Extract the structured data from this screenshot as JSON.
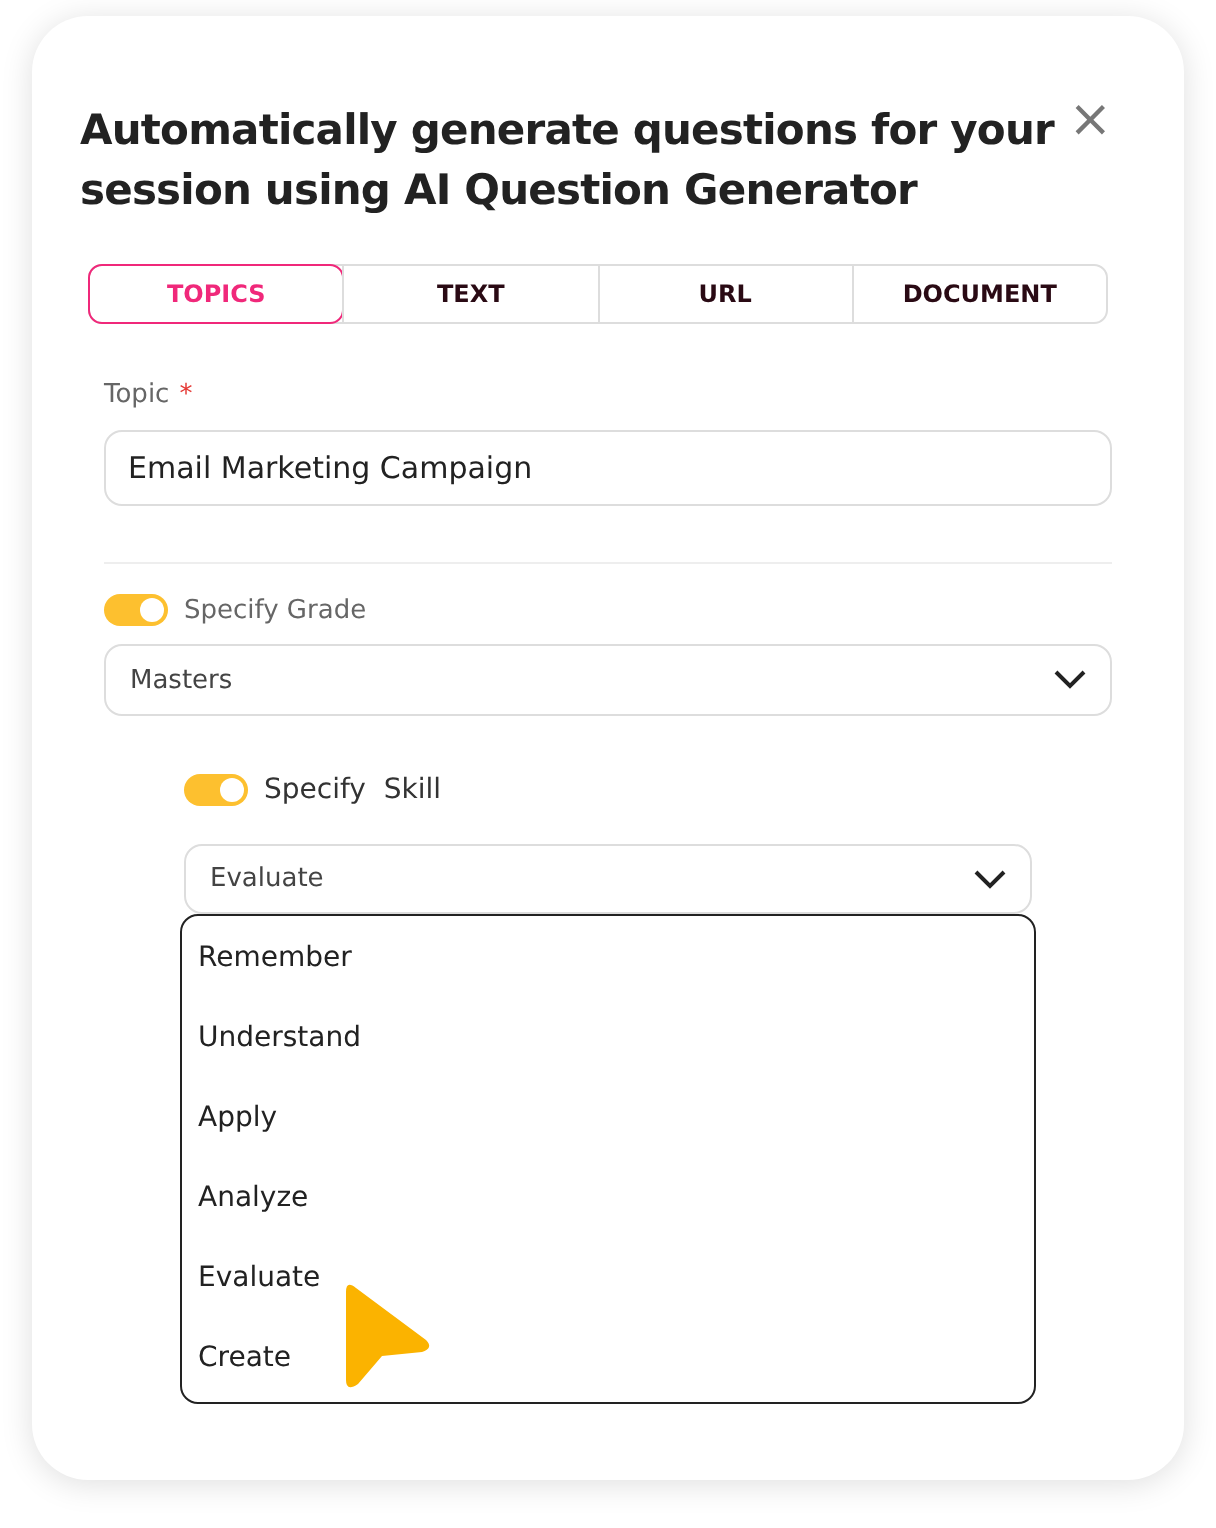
{
  "dialog": {
    "title": "Automatically generate questions for your session using AI Question Generator",
    "close": "×"
  },
  "tabs": [
    {
      "label": "TOPICS",
      "selected": true
    },
    {
      "label": "TEXT",
      "selected": false
    },
    {
      "label": "URL",
      "selected": false
    },
    {
      "label": "DOCUMENT",
      "selected": false
    }
  ],
  "topic": {
    "label": "Topic",
    "required_mark": "*",
    "value": "Email Marketing Campaign"
  },
  "grade": {
    "label": "Specify Grade",
    "on": true,
    "value": "Masters"
  },
  "skill": {
    "label": "Specify  Skill",
    "on": true,
    "value": "Evaluate",
    "expanded": true,
    "options": [
      "Remember",
      "Understand",
      "Apply",
      "Analyze",
      "Evaluate",
      "Create"
    ]
  }
}
